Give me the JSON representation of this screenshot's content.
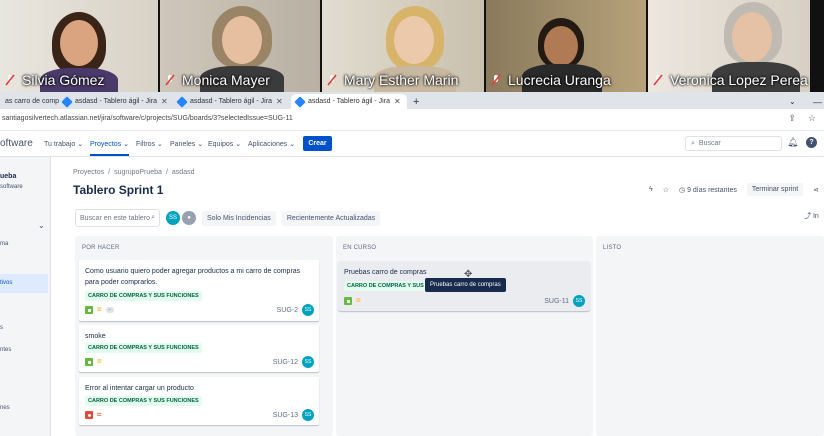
{
  "participants": [
    {
      "name": "Silvia Gómez"
    },
    {
      "name": "Monica Mayer"
    },
    {
      "name": "Mary Esther Marin"
    },
    {
      "name": "Lucrecia Uranga"
    },
    {
      "name": "Veronica Lopez Perea"
    }
  ],
  "browser": {
    "tabs": [
      {
        "label": "as carro de comp"
      },
      {
        "label": "asdasd - Tablero ágil - Jira"
      },
      {
        "label": "asdasd - Tablero ágil - Jira"
      },
      {
        "label": "asdasd - Tablero ágil - Jira"
      }
    ],
    "new_tab": "+",
    "url": "santiagosilvertech.atlassian.net/jira/software/c/projects/SUG/boards/3?selectedIssue=SUG-11"
  },
  "nav": {
    "brand": "oftware",
    "menus": [
      "Tu trabajo",
      "Proyectos",
      "Filtros",
      "Paneles",
      "Equipos",
      "Aplicaciones"
    ],
    "create": "Crear",
    "search_placeholder": "Buscar"
  },
  "sidebar": {
    "project_name": "ueba",
    "project_type": "software",
    "items": [
      "ma",
      "tivos",
      "s",
      "ntes",
      "nes"
    ]
  },
  "board": {
    "breadcrumb": [
      "Proyectos",
      "/",
      "sugrupoPrueba",
      "/",
      "asdasd"
    ],
    "title": "Tablero Sprint 1",
    "days_left": "9 días restantes",
    "complete_sprint": "Terminar sprint",
    "search_placeholder": "Buscar en este tablero",
    "avatar_initials": "SS",
    "quick_filters": [
      "Solo Mis Incidencias",
      "Recientemente Actualizadas"
    ],
    "insights": "In",
    "columns": [
      {
        "name": "POR HACER"
      },
      {
        "name": "EN CURSO"
      },
      {
        "name": "LISTO"
      }
    ],
    "cards": [
      {
        "title": "Como usuario quiero poder agregar productos a mi carro de compras para poder comprarlos.",
        "epic": "CARRO DE COMPRAS Y SUS FUNCIONES",
        "key": "SUG-2",
        "assignee": "SS",
        "type": "story",
        "extra": "-"
      },
      {
        "title": "smoke",
        "epic": "CARRO DE COMPRAS Y SUS FUNCIONES",
        "key": "SUG-12",
        "assignee": "SS",
        "type": "story"
      },
      {
        "title": "Error al intentar cargar un producto",
        "epic": "CARRO DE COMPRAS Y SUS FUNCIONES",
        "key": "SUG-13",
        "assignee": "SS",
        "type": "bug"
      },
      {
        "title": "Pruebas carro de compras",
        "epic": "CARRO DE COMPRAS Y SUS FU",
        "key": "SUG-11",
        "assignee": "SS",
        "type": "story"
      }
    ],
    "tooltip": "Pruebas carro de compras"
  },
  "colors": {
    "accent": "#0052cc",
    "epic_bg": "#e3fcef",
    "epic_text": "#006644",
    "story": "#63ba3c",
    "bug": "#e5493a",
    "column_bg": "#f4f5f7"
  }
}
